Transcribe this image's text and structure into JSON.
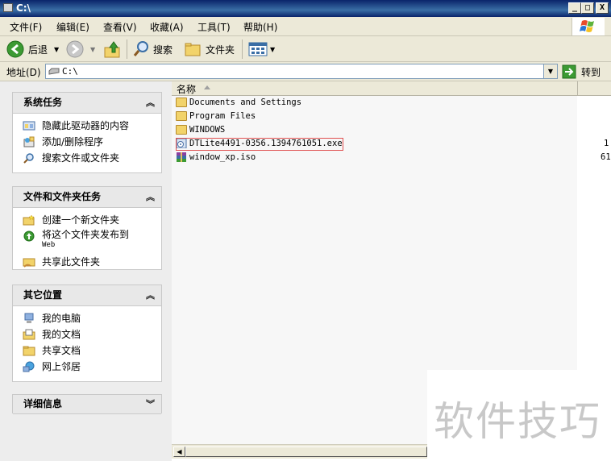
{
  "window": {
    "title": "C:\\"
  },
  "caption_buttons": {
    "minimize": "_",
    "maximize": "□",
    "close": "X"
  },
  "menu": [
    "文件(F)",
    "编辑(E)",
    "查看(V)",
    "收藏(A)",
    "工具(T)",
    "帮助(H)"
  ],
  "toolbar": {
    "back": "后退",
    "search": "搜索",
    "folders": "文件夹"
  },
  "address": {
    "label": "地址(D)",
    "value": "C:\\",
    "go": "转到"
  },
  "panels": {
    "system": {
      "title": "系统任务",
      "items": [
        "隐藏此驱动器的内容",
        "添加/删除程序",
        "搜索文件或文件夹"
      ]
    },
    "folder": {
      "title": "文件和文件夹任务",
      "items": [
        "创建一个新文件夹",
        "将这个文件夹发布到",
        "Web",
        "共享此文件夹"
      ]
    },
    "other": {
      "title": "其它位置",
      "items": [
        "我的电脑",
        "我的文档",
        "共享文档",
        "网上邻居"
      ]
    },
    "details": {
      "title": "详细信息"
    }
  },
  "list": {
    "column": "名称",
    "files": [
      {
        "name": "Documents and Settings",
        "size": ""
      },
      {
        "name": "Program Files",
        "size": ""
      },
      {
        "name": "WINDOWS",
        "size": ""
      },
      {
        "name": "DTLite4491-0356.1394761051.exe",
        "size": "1"
      },
      {
        "name": "window_xp.iso",
        "size": "61"
      }
    ]
  },
  "watermark": {
    "text": "软件技巧"
  },
  "colors": {
    "title_bar": "#0a246a",
    "highlight_box": "#e05050",
    "folder": "#f2d36a"
  }
}
